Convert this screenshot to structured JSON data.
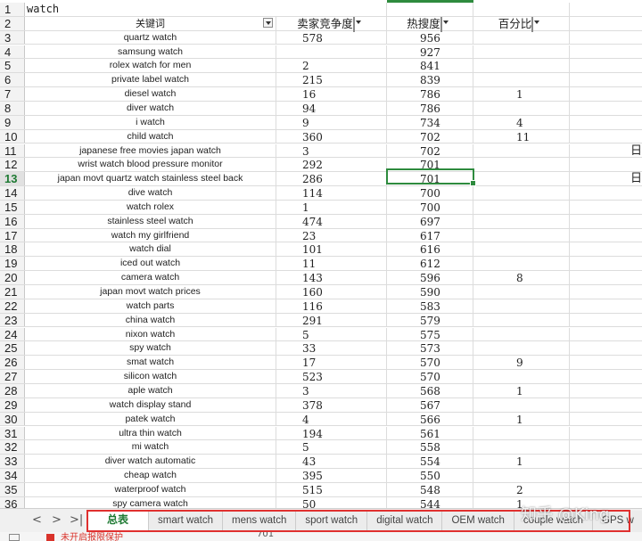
{
  "sheet": {
    "title_cell": "watch",
    "headers": {
      "keyword": "关键词",
      "competition": "卖家竞争度",
      "heat": "热搜度",
      "percent": "百分比"
    },
    "rows": [
      {
        "n": "3",
        "kw": "quartz watch",
        "comp": "578",
        "heat": "956",
        "pct": "",
        "extra": ""
      },
      {
        "n": "4",
        "kw": "samsung watch",
        "comp": "",
        "heat": "927",
        "pct": "",
        "extra": ""
      },
      {
        "n": "5",
        "kw": "rolex watch for men",
        "comp": "2",
        "heat": "841",
        "pct": "",
        "extra": ""
      },
      {
        "n": "6",
        "kw": "private label watch",
        "comp": "215",
        "heat": "839",
        "pct": "",
        "extra": ""
      },
      {
        "n": "7",
        "kw": "diesel watch",
        "comp": "16",
        "heat": "786",
        "pct": "1",
        "extra": ""
      },
      {
        "n": "8",
        "kw": "diver watch",
        "comp": "94",
        "heat": "786",
        "pct": "",
        "extra": ""
      },
      {
        "n": "9",
        "kw": "i watch",
        "comp": "9",
        "heat": "734",
        "pct": "4",
        "extra": ""
      },
      {
        "n": "10",
        "kw": "child watch",
        "comp": "360",
        "heat": "702",
        "pct": "11",
        "extra": ""
      },
      {
        "n": "11",
        "kw": "japanese free movies japan watch",
        "comp": "3",
        "heat": "702",
        "pct": "",
        "extra": "日"
      },
      {
        "n": "12",
        "kw": "wrist watch blood pressure monitor",
        "comp": "292",
        "heat": "701",
        "pct": "",
        "extra": ""
      },
      {
        "n": "13",
        "kw": "japan movt quartz watch stainless steel back",
        "comp": "286",
        "heat": "701",
        "pct": "",
        "extra": "日"
      },
      {
        "n": "14",
        "kw": "dive watch",
        "comp": "114",
        "heat": "700",
        "pct": "",
        "extra": ""
      },
      {
        "n": "15",
        "kw": "watch rolex",
        "comp": "1",
        "heat": "700",
        "pct": "",
        "extra": ""
      },
      {
        "n": "16",
        "kw": "stainless steel watch",
        "comp": "474",
        "heat": "697",
        "pct": "",
        "extra": ""
      },
      {
        "n": "17",
        "kw": "watch my girlfriend",
        "comp": "23",
        "heat": "617",
        "pct": "",
        "extra": ""
      },
      {
        "n": "18",
        "kw": "watch dial",
        "comp": "101",
        "heat": "616",
        "pct": "",
        "extra": ""
      },
      {
        "n": "19",
        "kw": "iced out watch",
        "comp": "11",
        "heat": "612",
        "pct": "",
        "extra": ""
      },
      {
        "n": "20",
        "kw": "camera watch",
        "comp": "143",
        "heat": "596",
        "pct": "8",
        "extra": ""
      },
      {
        "n": "21",
        "kw": "japan movt watch prices",
        "comp": "160",
        "heat": "590",
        "pct": "",
        "extra": ""
      },
      {
        "n": "22",
        "kw": "watch parts",
        "comp": "116",
        "heat": "583",
        "pct": "",
        "extra": ""
      },
      {
        "n": "23",
        "kw": "china watch",
        "comp": "291",
        "heat": "579",
        "pct": "",
        "extra": ""
      },
      {
        "n": "24",
        "kw": "nixon watch",
        "comp": "5",
        "heat": "575",
        "pct": "",
        "extra": ""
      },
      {
        "n": "25",
        "kw": "spy watch",
        "comp": "33",
        "heat": "573",
        "pct": "",
        "extra": ""
      },
      {
        "n": "26",
        "kw": "smat watch",
        "comp": "17",
        "heat": "570",
        "pct": "9",
        "extra": ""
      },
      {
        "n": "27",
        "kw": "silicon watch",
        "comp": "523",
        "heat": "570",
        "pct": "",
        "extra": ""
      },
      {
        "n": "28",
        "kw": "aple watch",
        "comp": "3",
        "heat": "568",
        "pct": "1",
        "extra": ""
      },
      {
        "n": "29",
        "kw": "watch display stand",
        "comp": "378",
        "heat": "567",
        "pct": "",
        "extra": ""
      },
      {
        "n": "30",
        "kw": "patek watch",
        "comp": "4",
        "heat": "566",
        "pct": "1",
        "extra": ""
      },
      {
        "n": "31",
        "kw": "ultra thin watch",
        "comp": "194",
        "heat": "561",
        "pct": "",
        "extra": ""
      },
      {
        "n": "32",
        "kw": "mi watch",
        "comp": "5",
        "heat": "558",
        "pct": "",
        "extra": ""
      },
      {
        "n": "33",
        "kw": "diver watch automatic",
        "comp": "43",
        "heat": "554",
        "pct": "1",
        "extra": ""
      },
      {
        "n": "34",
        "kw": "cheap watch",
        "comp": "395",
        "heat": "550",
        "pct": "",
        "extra": ""
      },
      {
        "n": "35",
        "kw": "waterproof watch",
        "comp": "515",
        "heat": "548",
        "pct": "2",
        "extra": ""
      },
      {
        "n": "36",
        "kw": "spy camera watch",
        "comp": "50",
        "heat": "544",
        "pct": "1",
        "extra": ""
      }
    ],
    "active_row": "13"
  },
  "tabs": [
    "总表",
    "smart watch",
    "mens watch",
    "sport watch",
    "digital watch",
    "OEM watch",
    "couple watch",
    "GPS w"
  ],
  "nav": {
    "prev": "<",
    "next": ">",
    "last": ">|"
  },
  "status": {
    "text": "未开启报限保护",
    "value": "701"
  },
  "watermark": "知乎 @King",
  "colors": {
    "accent": "#2e8b3e",
    "highlight_box": "#e0302f"
  }
}
